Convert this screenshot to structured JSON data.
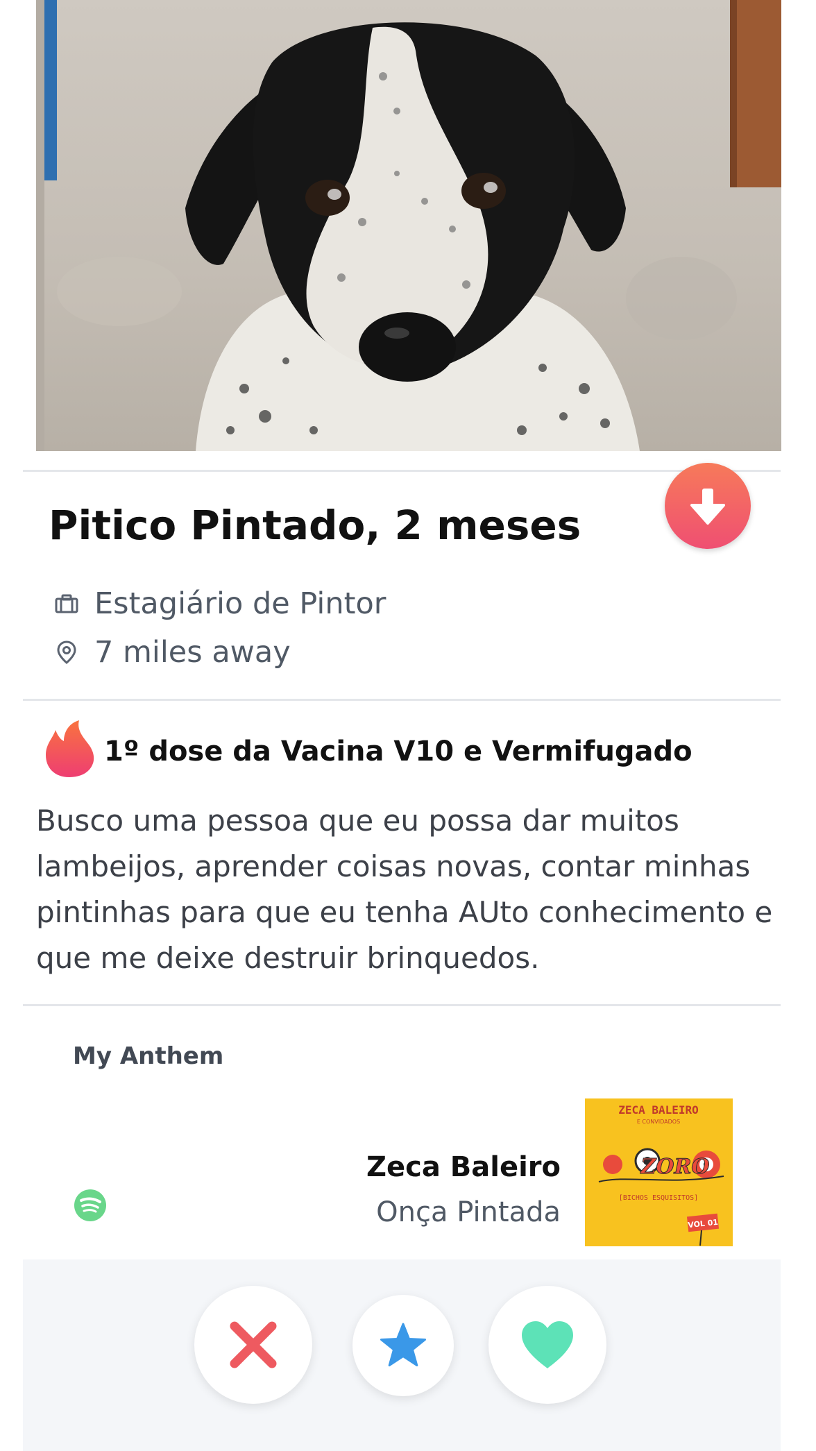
{
  "profile": {
    "name_age": "Pitico Pintado, 2 meses",
    "job": "Estagiário de Pintor",
    "distance": "7 miles away"
  },
  "bio": {
    "headline": "1º dose da Vacina V10 e Vermifugado",
    "text": "Busco uma pessoa que eu possa dar muitos lambeijos, aprender coisas novas, contar minhas pintinhas para que eu tenha AUto conhecimento e que me deixe destruir brinquedos."
  },
  "anthem": {
    "label": "My Anthem",
    "artist": "Zeca Baleiro",
    "song": "Onça Pintada",
    "album_art_lines": [
      "ZECA BALEIRO",
      "E CONVIDADOS",
      "ZORO",
      "[BICHOS ESQUISITOS]",
      "VOL 01"
    ]
  },
  "icons": {
    "collapse": "arrow-down-icon",
    "job": "briefcase-icon",
    "distance": "location-pin-icon",
    "flame": "tinder-flame-icon",
    "spotify": "spotify-icon",
    "nope": "x-icon",
    "superlike": "star-icon",
    "like": "heart-icon"
  },
  "colors": {
    "accent_gradient_start": "#f77a5a",
    "accent_gradient_end": "#ef4f72",
    "nope": "#ee5a60",
    "superlike": "#3a98e8",
    "like": "#5de2b7",
    "spotify": "#69d68a",
    "album_bg": "#f8c21f"
  }
}
